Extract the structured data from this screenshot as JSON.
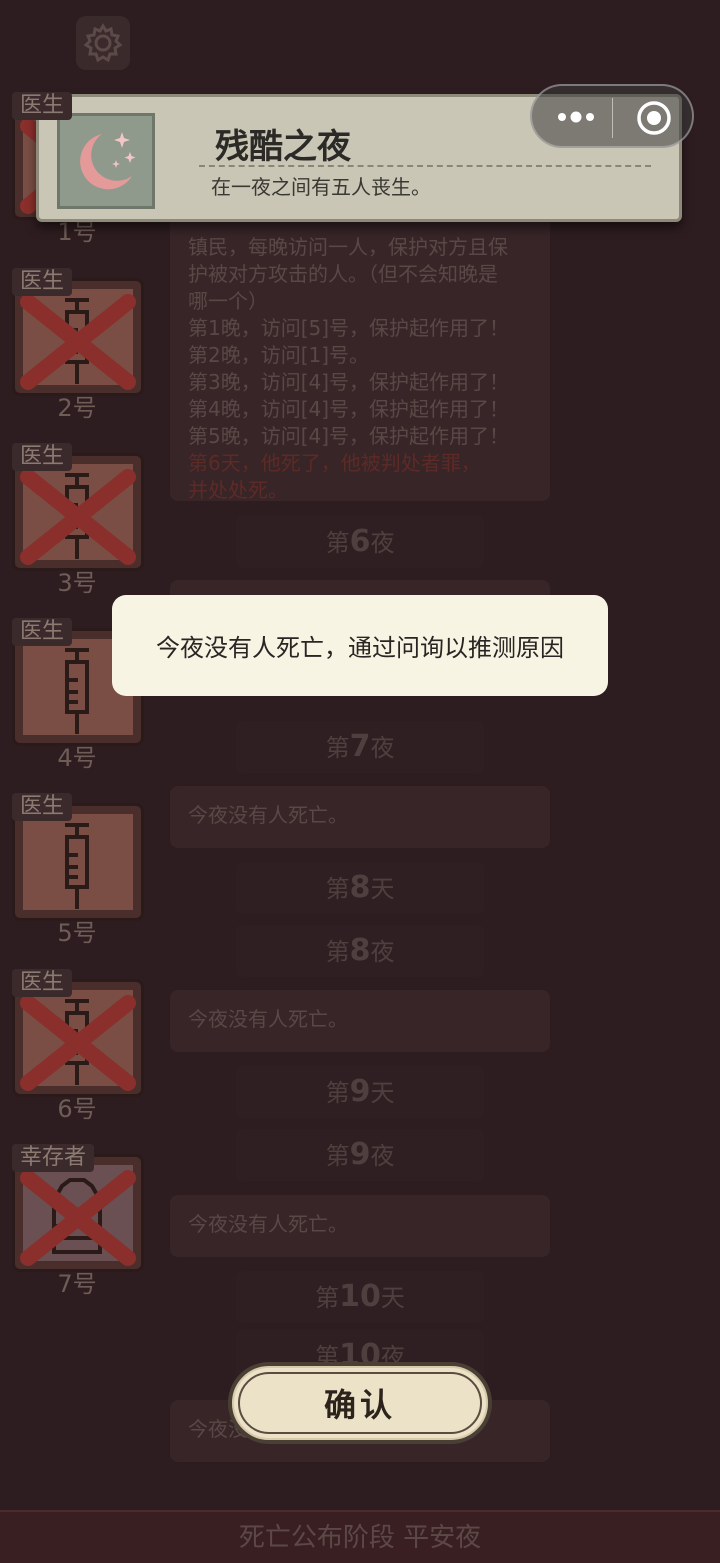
{
  "players": [
    {
      "role": "医生",
      "number": "1号",
      "dead": true
    },
    {
      "role": "医生",
      "number": "2号",
      "dead": true
    },
    {
      "role": "医生",
      "number": "3号",
      "dead": true
    },
    {
      "role": "医生",
      "number": "4号",
      "dead": false
    },
    {
      "role": "医生",
      "number": "5号",
      "dead": false
    },
    {
      "role": "医生",
      "number": "6号",
      "dead": true
    },
    {
      "role": "幸存者",
      "number": "7号",
      "dead": true
    }
  ],
  "log": {
    "entry1": {
      "line1": "镇民，每晚访问一人，保护对方且保",
      "line2": "护被对方攻击的人。（但不会知晚是",
      "line3": "哪一个）",
      "line4": "第1晚，访问[5]号，保护起作用了！",
      "line5": "第2晚，访问[1]号。",
      "line6": "第3晚，访问[4]号，保护起作用了！",
      "line7": "第4晚，访问[4]号，保护起作用了！",
      "line8": "第5晚，访问[4]号，保护起作用了！",
      "red1": "第6天，他死了，他被判处者罪，",
      "red2": "并处处死。"
    },
    "night6": {
      "pre": "第",
      "num": "6",
      "post": "夜"
    },
    "night7": {
      "pre": "第",
      "num": "7",
      "post": "夜"
    },
    "night7_text": "今夜没有人死亡。",
    "day8": {
      "pre": "第",
      "num": "8",
      "post": "天"
    },
    "night8": {
      "pre": "第",
      "num": "8",
      "post": "夜"
    },
    "night8_text": "今夜没有人死亡。",
    "day9": {
      "pre": "第",
      "num": "9",
      "post": "天"
    },
    "night9": {
      "pre": "第",
      "num": "9",
      "post": "夜"
    },
    "night9_text": "今夜没有人死亡。",
    "day10": {
      "pre": "第",
      "num": "10",
      "post": "天"
    },
    "night10": {
      "pre": "第",
      "num": "10",
      "post": "夜"
    },
    "night10_text": "今夜没"
  },
  "banner": {
    "title": "残酷之夜",
    "description": "在一夜之间有五人丧生。"
  },
  "toast": {
    "text": "今夜没有人死亡，通过问询以推测原因"
  },
  "confirm": {
    "label": "确认"
  },
  "bottom_bar": {
    "text": "死亡公布阶段 平安夜"
  },
  "colors": {
    "accent_red": "#c8372f",
    "banner_bg": "#c9c6b6",
    "toast_bg": "#f7f4e4"
  }
}
